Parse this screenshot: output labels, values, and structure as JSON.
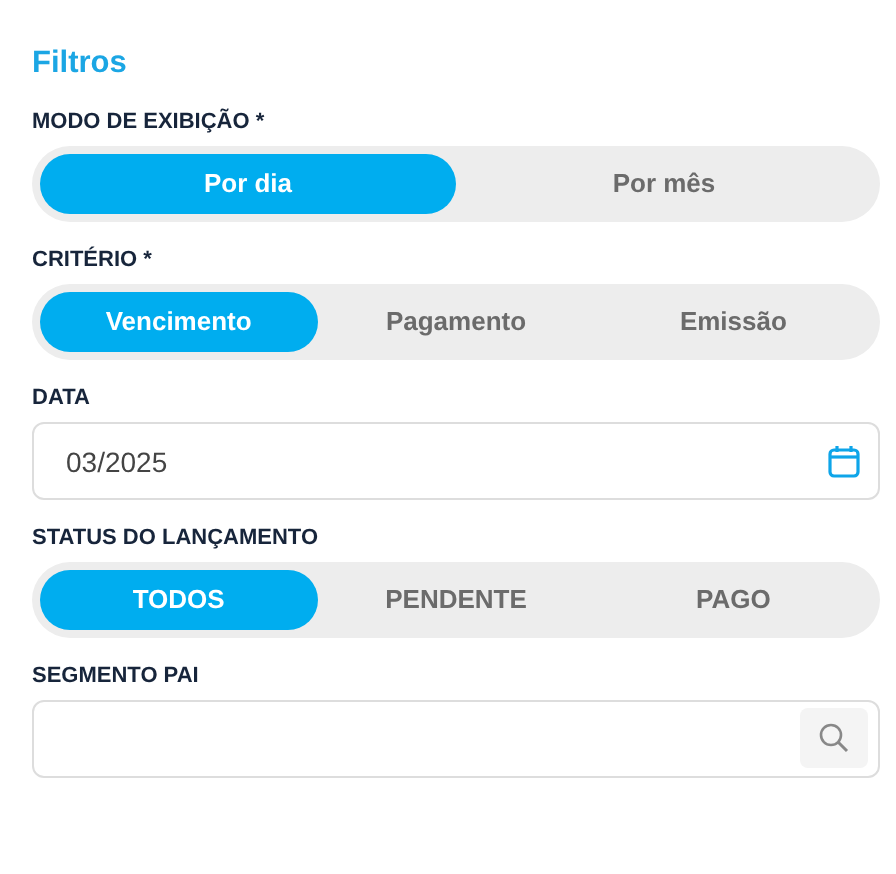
{
  "title": "Filtros",
  "fields": [
    {
      "kind": "segmented",
      "label": "MODO DE EXIBIÇÃO *",
      "options": [
        {
          "label": "Por dia",
          "selected": true
        },
        {
          "label": "Por mês",
          "selected": false
        }
      ]
    },
    {
      "kind": "segmented",
      "label": "CRITÉRIO *",
      "options": [
        {
          "label": "Vencimento",
          "selected": true
        },
        {
          "label": "Pagamento",
          "selected": false
        },
        {
          "label": "Emissão",
          "selected": false
        }
      ]
    },
    {
      "kind": "date",
      "label": "DATA",
      "value": "03/2025"
    },
    {
      "kind": "segmented",
      "label": "STATUS DO LANÇAMENTO",
      "options": [
        {
          "label": "TODOS",
          "selected": true
        },
        {
          "label": "PENDENTE",
          "selected": false
        },
        {
          "label": "PAGO",
          "selected": false
        }
      ]
    },
    {
      "kind": "search",
      "label": "SEGMENTO PAI"
    }
  ]
}
